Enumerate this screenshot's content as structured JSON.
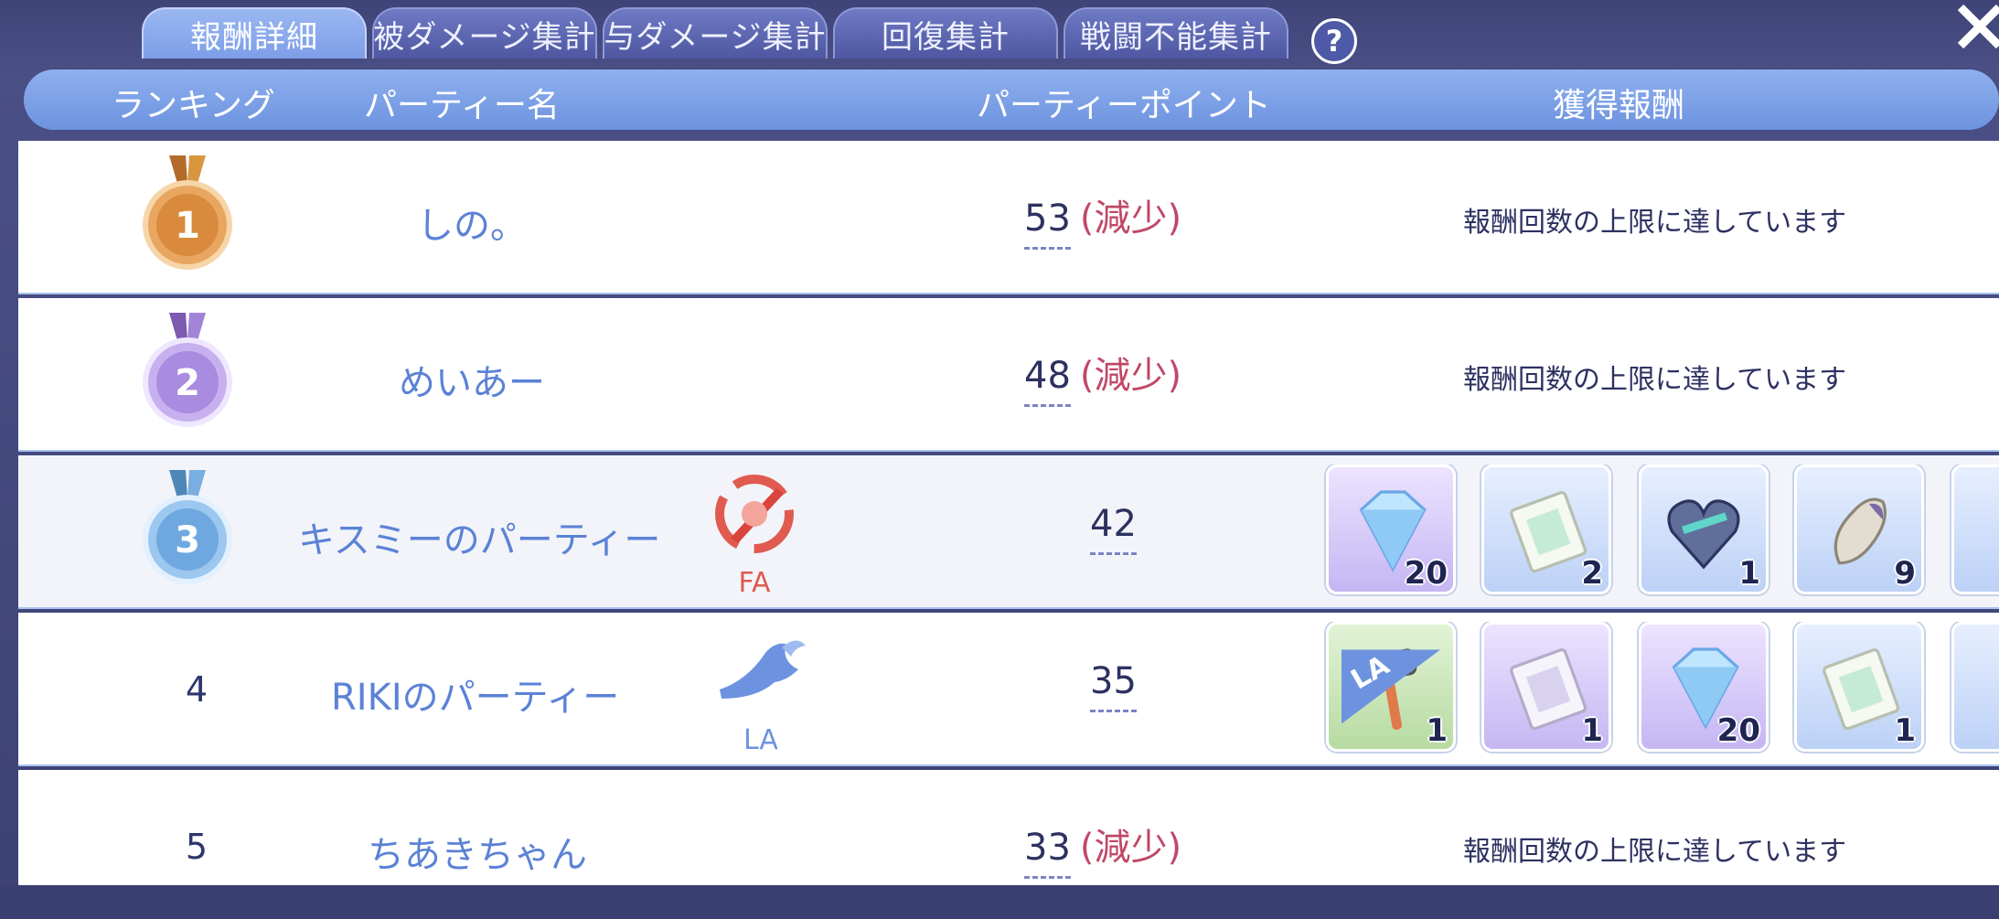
{
  "tabs": [
    {
      "label": "報酬詳細",
      "active": true
    },
    {
      "label": "被ダメージ集計"
    },
    {
      "label": "与ダメージ集計"
    },
    {
      "label": "回復集計"
    },
    {
      "label": "戦闘不能集計"
    }
  ],
  "help_label": "?",
  "header": {
    "rank": "ランキング",
    "party_name": "パーティー名",
    "party_points": "パーティーポイント",
    "reward": "獲得報酬"
  },
  "rows": [
    {
      "rank": "1",
      "name": "しの。",
      "points": "53",
      "points_note": "(減少)",
      "reward_text": "報酬回数の上限に達しています"
    },
    {
      "rank": "2",
      "name": "めいあー",
      "points": "48",
      "points_note": "(減少)",
      "reward_text": "報酬回数の上限に達しています"
    },
    {
      "rank": "3",
      "name": "キスミーのパーティー",
      "badge": "FA",
      "badge_color": "#e05a50",
      "points": "42",
      "items": [
        {
          "qty": "20",
          "icon": "crystal-icon"
        },
        {
          "qty": "2",
          "icon": "card-icon"
        },
        {
          "qty": "1",
          "icon": "heart-crystal-icon"
        },
        {
          "qty": "9",
          "icon": "stone-icon"
        }
      ]
    },
    {
      "rank": "4",
      "name": "RIKIのパーティー",
      "badge": "LA",
      "badge_color": "#6d93e0",
      "points": "35",
      "items": [
        {
          "qty": "1",
          "icon": "hammer-icon",
          "ribbon": "LA"
        },
        {
          "qty": "1",
          "icon": "card-icon"
        },
        {
          "qty": "20",
          "icon": "crystal-icon"
        },
        {
          "qty": "1",
          "icon": "card-icon"
        }
      ]
    },
    {
      "rank": "5",
      "name": "ちあきちゃん",
      "points": "33",
      "points_note": "(減少)",
      "reward_text": "報酬回数の上限に達しています"
    }
  ]
}
